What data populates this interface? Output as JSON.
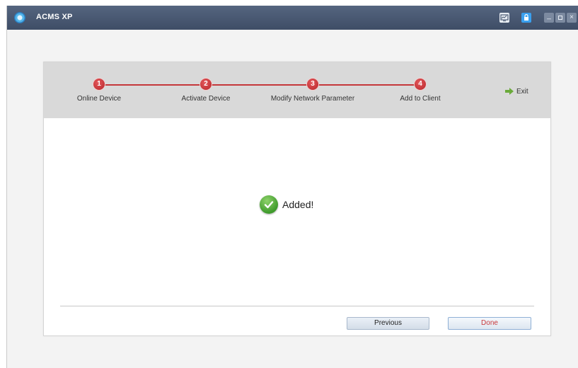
{
  "app": {
    "title": "ACMS XP"
  },
  "titlebar": {
    "buttons": {
      "minimize": "_",
      "close": "×"
    },
    "icons": [
      "app-logo-icon",
      "monitor-icon",
      "lock-icon",
      "minimize-icon",
      "maximize-icon",
      "close-icon"
    ]
  },
  "wizard": {
    "steps": [
      {
        "number": "1",
        "label": "Online Device"
      },
      {
        "number": "2",
        "label": "Activate Device"
      },
      {
        "number": "3",
        "label": "Modify Network Parameter"
      },
      {
        "number": "4",
        "label": "Add to Client"
      }
    ],
    "exit_label": "Exit",
    "result_text": "Added!",
    "buttons": {
      "previous": "Previous",
      "done": "Done"
    }
  },
  "colors": {
    "titlebar": "#4a5a73",
    "step_accent": "#c5383b",
    "header_bg": "#d9d9d9",
    "success": "#3f9b2c",
    "done_text": "#c8383b"
  }
}
